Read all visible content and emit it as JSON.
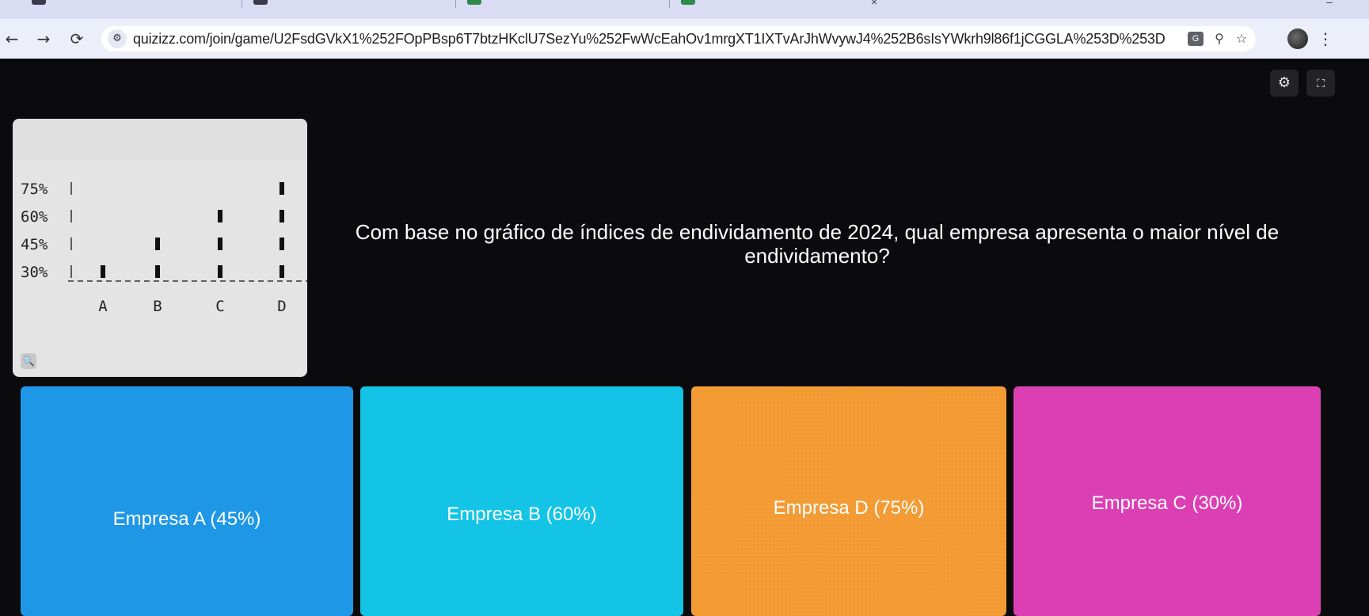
{
  "browser": {
    "url": "quizizz.com/join/game/U2FsdGVkX1%252FOpPBsp6T7btzHKclU7SezYu%252FwWcEahOv1mrgXT1IXTvArJhWvywJ4%252B6sIsYWkrh9l86f1jCGGLA%253D%253D",
    "back_icon": "←",
    "forward_icon": "→",
    "reload_icon": "⟳",
    "site_info_icon": "⚙",
    "translate_label": "G",
    "zoom_icon": "⚲",
    "bookmark_icon": "☆",
    "menu_icon": "⋮"
  },
  "page_controls": {
    "settings_icon": "⚙",
    "fullscreen_icon": "⛶"
  },
  "question": {
    "text": "Com base no gráfico de índices de endividamento de 2024, qual empresa apresenta o maior nível de endividamento?",
    "zoom_icon": "🔍"
  },
  "chart_data": {
    "type": "bar",
    "categories": [
      "A",
      "B",
      "C",
      "D"
    ],
    "yticks": [
      "75%",
      "60%",
      "45%",
      "30%"
    ],
    "ytick_values": [
      75,
      60,
      45,
      30
    ],
    "values": [
      30,
      45,
      60,
      75
    ],
    "ylim": [
      30,
      75
    ],
    "title": "",
    "xlabel": "",
    "ylabel": ""
  },
  "options": [
    {
      "label": "Empresa A (45%)",
      "color": "#1e97e6"
    },
    {
      "label": "Empresa B (60%)",
      "color": "#13c4e6"
    },
    {
      "label": "Empresa D (75%)",
      "color": "#f39a32"
    },
    {
      "label": "Empresa C (30%)",
      "color": "#dc3fb4"
    }
  ]
}
